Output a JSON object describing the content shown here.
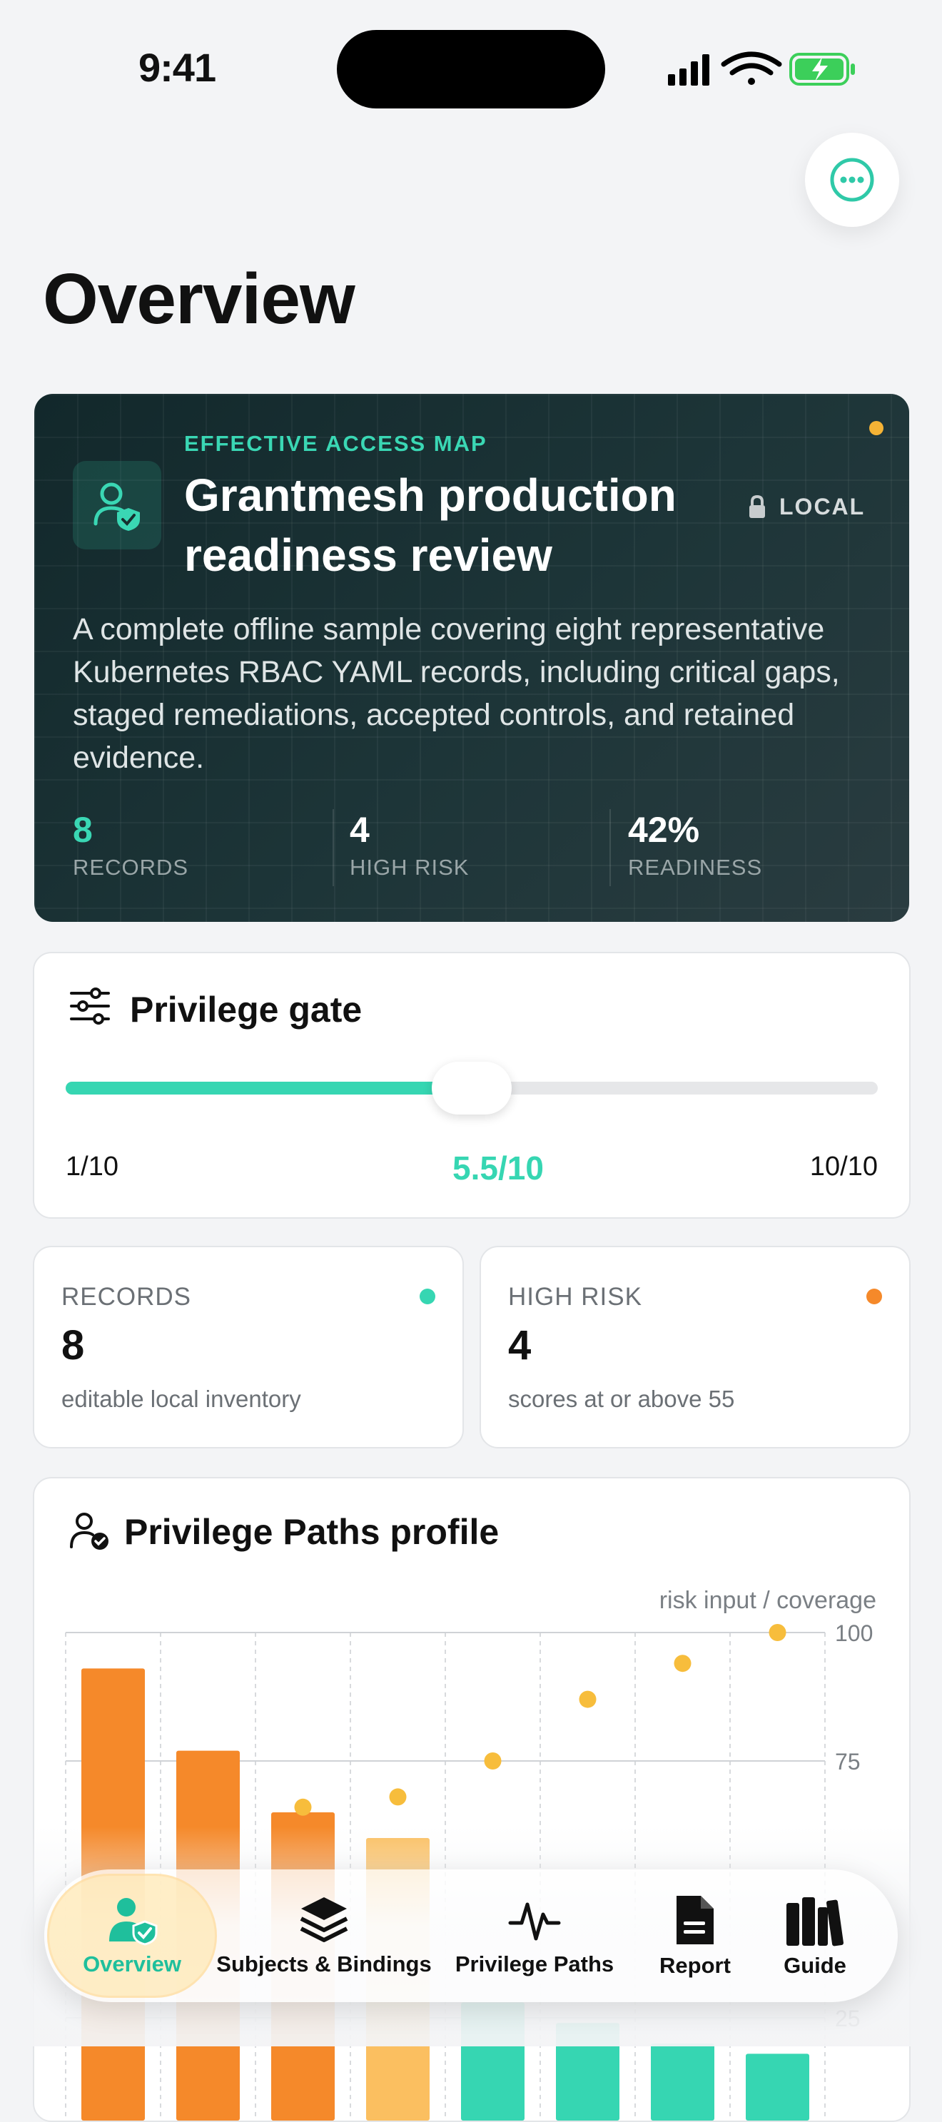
{
  "status": {
    "time": "9:41"
  },
  "page": {
    "title": "Overview"
  },
  "hero": {
    "kicker": "EFFECTIVE ACCESS MAP",
    "title": "Grantmesh production readiness review",
    "badge": "LOCAL",
    "description": "A complete offline sample covering eight representative Kubernetes RBAC YAML records, including critical gaps, staged remediations, accepted controls, and retained evidence.",
    "stats": [
      {
        "value": "8",
        "label": "RECORDS",
        "color": "#3ad7b4"
      },
      {
        "value": "4",
        "label": "HIGH RISK",
        "color": "#ffffff"
      },
      {
        "value": "42%",
        "label": "READINESS",
        "color": "#ffffff"
      }
    ]
  },
  "gate": {
    "title": "Privilege gate",
    "min_label": "1/10",
    "value_label": "5.5/10",
    "max_label": "10/10",
    "value": 5.5,
    "min": 1,
    "max": 10
  },
  "summary_cards": [
    {
      "label": "RECORDS",
      "value": "8",
      "sub": "editable local inventory",
      "dot_color": "#36d6b2"
    },
    {
      "label": "HIGH RISK",
      "value": "4",
      "sub": "scores at or above 55",
      "dot_color": "#f5892a"
    }
  ],
  "paths_card": {
    "title": "Privilege Paths profile",
    "caption": "risk input / coverage"
  },
  "chart_data": {
    "type": "bar",
    "y_ticks": [
      "100",
      "75",
      "25"
    ],
    "ylim": [
      0,
      100
    ],
    "bars": [
      93,
      77,
      65,
      60,
      28,
      24,
      20,
      18
    ],
    "bar_colors": [
      "#f5892a",
      "#f5892a",
      "#f5892a",
      "#fbbf60",
      "#36d6b2",
      "#36d6b2",
      "#36d6b2",
      "#36d6b2"
    ],
    "coverage": [
      null,
      null,
      66,
      68,
      75,
      87,
      94,
      100
    ]
  },
  "tabbar": {
    "tabs": [
      {
        "label": "Overview",
        "icon": "user-shield-icon",
        "active": true
      },
      {
        "label": "Subjects & Bindings",
        "icon": "layers-icon",
        "active": false
      },
      {
        "label": "Privilege Paths",
        "icon": "pulse-icon",
        "active": false
      },
      {
        "label": "Report",
        "icon": "document-icon",
        "active": false
      },
      {
        "label": "Guide",
        "icon": "books-icon",
        "active": false
      }
    ]
  }
}
